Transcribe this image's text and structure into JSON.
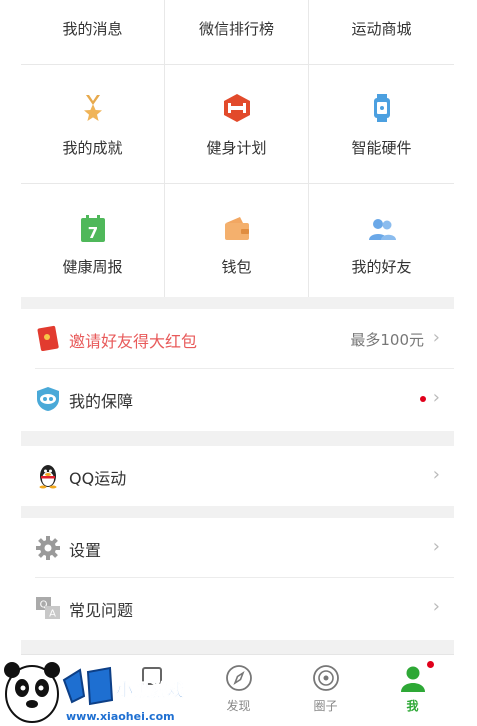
{
  "grid": {
    "row0": [
      "我的消息",
      "微信排行榜",
      "运动商城"
    ],
    "row1": [
      {
        "label": "我的成就",
        "icon": "medal-icon"
      },
      {
        "label": "健身计划",
        "icon": "fitness-plan-icon"
      },
      {
        "label": "智能硬件",
        "icon": "smartwatch-icon"
      }
    ],
    "row2": [
      {
        "label": "健康周报",
        "icon": "calendar-7-icon"
      },
      {
        "label": "钱包",
        "icon": "wallet-icon"
      },
      {
        "label": "我的好友",
        "icon": "friends-icon"
      }
    ]
  },
  "invite": {
    "label": "邀请好友得大红包",
    "value": "最多100元",
    "icon": "red-envelope-icon",
    "accent": "#e85a5a"
  },
  "insurance": {
    "label": "我的保障",
    "icon": "shield-icon",
    "dot_color": "#e0001b"
  },
  "qq": {
    "label": "QQ运动",
    "icon": "qq-penguin-icon"
  },
  "settings": {
    "label": "设置",
    "icon": "gear-icon"
  },
  "faq": {
    "label": "常见问题",
    "icon": "qa-icon"
  },
  "tabs": [
    {
      "label": "",
      "icon": "tab-icon"
    },
    {
      "label": "",
      "icon": "tab-icon"
    },
    {
      "label": "发现",
      "icon": "compass-icon"
    },
    {
      "label": "圈子",
      "icon": "circle-icon"
    },
    {
      "label": "我",
      "icon": "me-icon",
      "active": true
    }
  ],
  "watermark": {
    "brand": "小黑游戏",
    "url": "www.xiaohei.com"
  },
  "colors": {
    "active_tab": "#2ea836",
    "brand_green": "#2ea836"
  }
}
